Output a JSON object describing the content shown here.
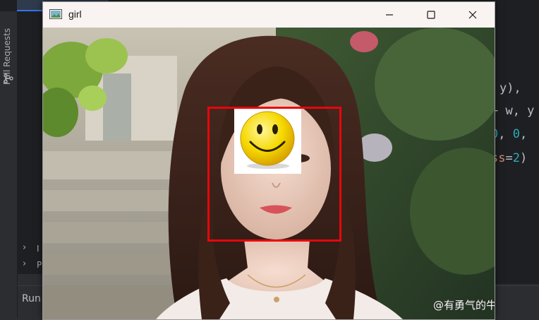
{
  "ide": {
    "side_panel_label": "Pull Requests",
    "code_lines": [
      {
        "parts": [
          {
            "t": "y),",
            "c": "pl"
          }
        ]
      },
      {
        "parts": [
          {
            "t": "+ w, y",
            "c": "pl"
          }
        ]
      },
      {
        "parts": [
          {
            "t": "0",
            "c": "num"
          },
          {
            "t": ", ",
            "c": "pl"
          },
          {
            "t": "0",
            "c": "num"
          },
          {
            "t": ",",
            "c": "pl"
          }
        ]
      },
      {
        "parts": [
          {
            "t": "ss",
            "c": "kw"
          },
          {
            "t": "=",
            "c": "pl"
          },
          {
            "t": "2",
            "c": "num"
          },
          {
            "t": ")",
            "c": "pl"
          }
        ]
      }
    ],
    "tree_items": [
      {
        "label": "I"
      },
      {
        "label": "P"
      }
    ],
    "run_label": "Run"
  },
  "window": {
    "title": "girl",
    "controls": {
      "minimize": "minimize-icon",
      "maximize": "maximize-icon",
      "close": "close-icon"
    }
  },
  "image": {
    "overlay": "smiley-emoji",
    "detection_box_color": "#e8060c",
    "watermark": "@有勇气的牛排"
  },
  "colors": {
    "ide_bg": "#1e1f22",
    "ide_panel": "#2b2d30",
    "window_chrome": "#f9f3f2",
    "accent": "#3574f0"
  }
}
